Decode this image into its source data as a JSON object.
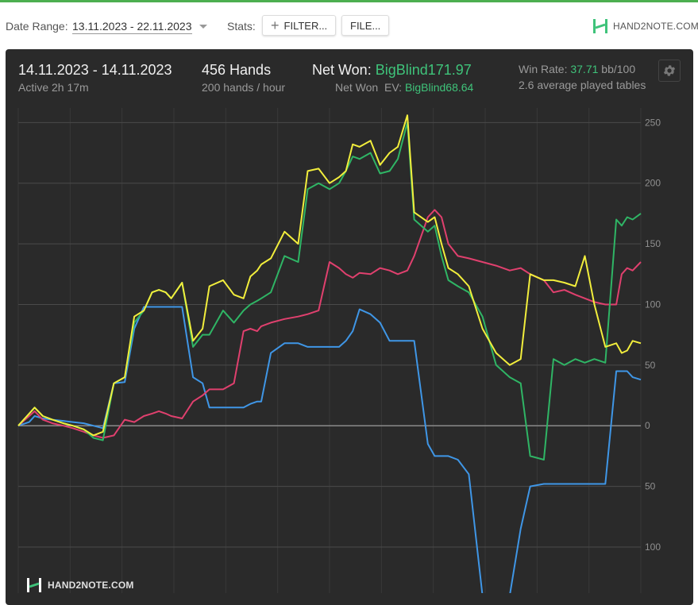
{
  "toolbar": {
    "date_range_label": "Date Range:",
    "date_range_value": "13.11.2023 - 22.11.2023",
    "stats_label": "Stats:",
    "filter_button": "FILTER...",
    "file_button": "FILE...",
    "brand": "HAND2NOTE.COM"
  },
  "summary": {
    "period": "14.11.2023 - 14.11.2023",
    "active": "Active 2h 17m",
    "hands": "456 Hands",
    "hands_rate": "200 hands / hour",
    "net_won_label": "Net Won:",
    "net_won_value": "BigBlind171.97",
    "ev_label": "Net Won  EV:",
    "ev_value": "BigBlind68.64",
    "win_rate_label": "Win Rate:",
    "win_rate_value": "37.71",
    "win_rate_unit": "bb/100",
    "tables": "2.6 average played tables"
  },
  "watermark": "HAND2NOTE.COM",
  "colors": {
    "panel": "#2a2a2a",
    "accent_green": "#3fc37a",
    "series_yellow": "#f2ee3c",
    "series_green": "#2fb565",
    "series_red": "#e0406e",
    "series_blue": "#3f96e6"
  },
  "chart_data": {
    "type": "line",
    "x_label": "",
    "y_label": "",
    "x_range": [
      0,
      456
    ],
    "y_range": [
      -138,
      262
    ],
    "y_ticks": [
      250,
      200,
      150,
      100,
      50,
      0,
      50,
      100
    ],
    "y_tick_values": [
      250,
      200,
      150,
      100,
      50,
      0,
      -50,
      -100
    ],
    "grid": true,
    "series": [
      {
        "key": "yellow",
        "color": "#f2ee3c",
        "x": [
          0,
          8,
          12,
          18,
          25,
          33,
          40,
          48,
          55,
          62,
          70,
          78,
          85,
          92,
          98,
          103,
          108,
          112,
          120,
          128,
          135,
          140,
          150,
          158,
          165,
          170,
          175,
          178,
          185,
          195,
          205,
          212,
          220,
          228,
          235,
          240,
          245,
          250,
          258,
          265,
          272,
          278,
          285,
          290,
          300,
          305,
          310,
          315,
          322,
          330,
          340,
          350,
          360,
          368,
          375,
          385,
          392,
          400,
          408,
          415,
          422,
          430,
          438,
          442,
          446,
          450,
          456
        ],
        "y": [
          0,
          10,
          15,
          8,
          5,
          2,
          0,
          -3,
          -8,
          -5,
          35,
          40,
          90,
          95,
          110,
          112,
          110,
          105,
          118,
          70,
          80,
          115,
          120,
          108,
          105,
          123,
          128,
          133,
          138,
          160,
          150,
          210,
          212,
          200,
          205,
          210,
          232,
          230,
          235,
          215,
          225,
          230,
          256,
          176,
          168,
          172,
          150,
          130,
          125,
          115,
          80,
          60,
          50,
          55,
          125,
          120,
          120,
          118,
          115,
          140,
          100,
          65,
          68,
          60,
          62,
          70,
          68
        ]
      },
      {
        "key": "green",
        "color": "#2fb565",
        "x": [
          0,
          8,
          12,
          18,
          25,
          33,
          40,
          48,
          55,
          62,
          70,
          78,
          85,
          92,
          98,
          103,
          108,
          112,
          120,
          128,
          135,
          140,
          150,
          158,
          165,
          170,
          175,
          178,
          185,
          195,
          205,
          212,
          220,
          228,
          235,
          240,
          245,
          250,
          258,
          265,
          272,
          278,
          285,
          290,
          300,
          305,
          310,
          315,
          322,
          330,
          340,
          350,
          360,
          368,
          375,
          385,
          392,
          400,
          408,
          415,
          422,
          430,
          438,
          442,
          446,
          450,
          456
        ],
        "y": [
          0,
          10,
          15,
          8,
          5,
          2,
          0,
          -3,
          -10,
          -12,
          35,
          40,
          85,
          95,
          110,
          112,
          110,
          105,
          118,
          65,
          75,
          75,
          95,
          85,
          95,
          100,
          103,
          105,
          110,
          140,
          135,
          195,
          200,
          195,
          200,
          210,
          222,
          220,
          225,
          208,
          210,
          220,
          250,
          170,
          160,
          165,
          140,
          120,
          115,
          110,
          90,
          50,
          40,
          35,
          -25,
          -28,
          55,
          50,
          55,
          52,
          55,
          52,
          170,
          165,
          172,
          170,
          175
        ]
      },
      {
        "key": "red",
        "color": "#e0406e",
        "x": [
          0,
          8,
          12,
          18,
          25,
          33,
          40,
          48,
          55,
          62,
          70,
          78,
          85,
          92,
          98,
          103,
          108,
          112,
          120,
          128,
          135,
          140,
          150,
          158,
          165,
          170,
          175,
          178,
          185,
          195,
          205,
          212,
          220,
          228,
          235,
          240,
          245,
          250,
          258,
          265,
          272,
          278,
          285,
          290,
          300,
          305,
          310,
          315,
          322,
          330,
          340,
          350,
          360,
          368,
          375,
          385,
          392,
          400,
          408,
          415,
          422,
          430,
          438,
          442,
          446,
          450,
          456
        ],
        "y": [
          0,
          8,
          12,
          5,
          2,
          0,
          -2,
          -5,
          -8,
          -10,
          -8,
          5,
          3,
          8,
          10,
          12,
          10,
          8,
          6,
          20,
          25,
          30,
          30,
          35,
          78,
          80,
          78,
          82,
          85,
          88,
          90,
          92,
          95,
          135,
          130,
          125,
          122,
          126,
          125,
          130,
          128,
          125,
          128,
          140,
          172,
          178,
          172,
          150,
          140,
          138,
          135,
          132,
          128,
          130,
          125,
          120,
          110,
          112,
          108,
          105,
          102,
          100,
          100,
          125,
          130,
          128,
          135
        ]
      },
      {
        "key": "blue",
        "color": "#3f96e6",
        "x": [
          0,
          8,
          12,
          18,
          25,
          33,
          40,
          48,
          55,
          62,
          70,
          78,
          85,
          92,
          98,
          103,
          108,
          112,
          120,
          128,
          135,
          140,
          150,
          158,
          165,
          170,
          175,
          178,
          185,
          195,
          205,
          212,
          220,
          228,
          235,
          240,
          245,
          250,
          258,
          265,
          272,
          278,
          285,
          290,
          300,
          305,
          310,
          315,
          322,
          330,
          340,
          350,
          360,
          368,
          375,
          385,
          392,
          400,
          408,
          415,
          422,
          430,
          438,
          442,
          446,
          450,
          456
        ],
        "y": [
          0,
          3,
          8,
          6,
          5,
          4,
          3,
          2,
          0,
          -2,
          35,
          36,
          80,
          98,
          98,
          98,
          98,
          98,
          98,
          40,
          35,
          15,
          15,
          15,
          15,
          18,
          20,
          20,
          60,
          68,
          68,
          65,
          65,
          65,
          65,
          70,
          78,
          96,
          92,
          85,
          70,
          70,
          70,
          70,
          -15,
          -25,
          -25,
          -25,
          -28,
          -40,
          -140,
          -140,
          -140,
          -85,
          -50,
          -48,
          -48,
          -48,
          -48,
          -48,
          -48,
          -48,
          45,
          45,
          45,
          40,
          38
        ]
      }
    ]
  }
}
